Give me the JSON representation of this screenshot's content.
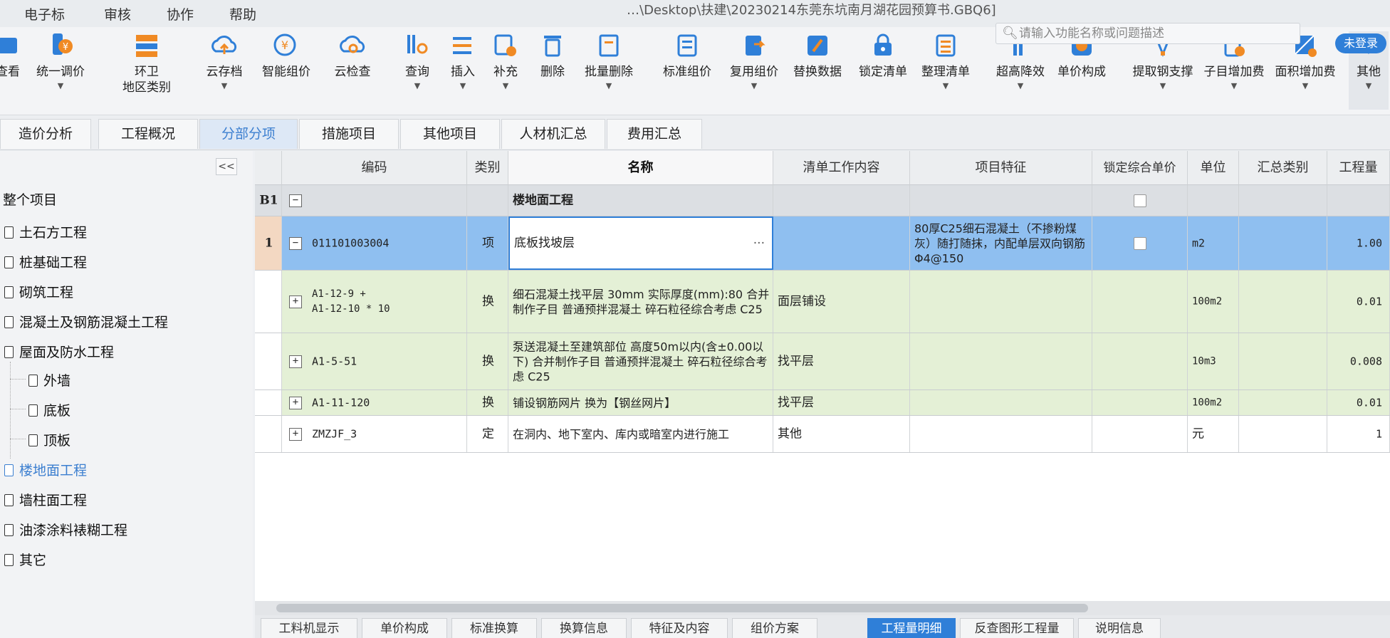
{
  "menu": {
    "items": [
      "电子标",
      "审核",
      "协作",
      "帮助"
    ],
    "window_title": "…\\Desktop\\扶建\\20230214东莞东坑南月湖花园预算书.GBQ6]"
  },
  "search": {
    "placeholder": "请输入功能名称或问题描述"
  },
  "login_badge": "未登录",
  "toolbar": {
    "items": [
      {
        "label": "查看",
        "icon": "view-icon"
      },
      {
        "label": "统一调价",
        "icon": "price-adjust-icon"
      },
      {
        "label": "环卫\n地区类别",
        "icon": "region-category-icon"
      },
      {
        "label": "云存档",
        "icon": "cloud-save-icon"
      },
      {
        "label": "智能组价",
        "icon": "smart-pricing-icon"
      },
      {
        "label": "云检查",
        "icon": "cloud-check-icon"
      },
      {
        "label": "查询",
        "icon": "query-icon"
      },
      {
        "label": "插入",
        "icon": "insert-icon"
      },
      {
        "label": "补充",
        "icon": "supplement-icon"
      },
      {
        "label": "删除",
        "icon": "delete-icon"
      },
      {
        "label": "批量删除",
        "icon": "batch-delete-icon"
      },
      {
        "label": "标准组价",
        "icon": "standard-pricing-icon"
      },
      {
        "label": "复用组价",
        "icon": "reuse-pricing-icon"
      },
      {
        "label": "替换数据",
        "icon": "replace-data-icon"
      },
      {
        "label": "锁定清单",
        "icon": "lock-list-icon"
      },
      {
        "label": "整理清单",
        "icon": "organize-list-icon"
      },
      {
        "label": "超高降效",
        "icon": "super-high-icon"
      },
      {
        "label": "单价构成",
        "icon": "unit-price-icon"
      },
      {
        "label": "提取钢支撑",
        "icon": "steel-support-icon"
      },
      {
        "label": "子目增加费",
        "icon": "sub-item-fee-icon"
      },
      {
        "label": "面积增加费",
        "icon": "area-fee-icon"
      },
      {
        "label": "其他",
        "icon": "other-icon"
      }
    ]
  },
  "tabs": [
    "造价分析",
    "工程概况",
    "分部分项",
    "措施项目",
    "其他项目",
    "人材机汇总",
    "费用汇总"
  ],
  "active_tab": "分部分项",
  "tree": {
    "collapse_label": "<<",
    "root": "整个项目",
    "nodes": [
      {
        "label": "土石方工程"
      },
      {
        "label": "桩基础工程"
      },
      {
        "label": "砌筑工程"
      },
      {
        "label": "混凝土及钢筋混凝土工程"
      },
      {
        "label": "屋面及防水工程"
      },
      {
        "label": "外墙"
      },
      {
        "label": "底板"
      },
      {
        "label": "顶板"
      },
      {
        "label": "楼地面工程"
      },
      {
        "label": "墙柱面工程"
      },
      {
        "label": "油漆涂料裱糊工程"
      },
      {
        "label": "其它"
      }
    ],
    "selected": "楼地面工程"
  },
  "grid": {
    "columns": [
      "编码",
      "类别",
      "名称",
      "清单工作内容",
      "项目特征",
      "锁定综合单价",
      "单位",
      "汇总类别",
      "工程量"
    ],
    "section_row": {
      "index": "B1",
      "expander": "−",
      "name": "楼地面工程"
    },
    "rows": [
      {
        "index": "1",
        "expander": "−",
        "code": "011101003004",
        "type": "项",
        "name": "底板找坡层",
        "work": "",
        "feature": "80厚C25细石混凝土（不掺粉煤灰）随打随抹，内配单层双向钢筋Φ4@150",
        "unit": "m2",
        "summary": "",
        "quantity": "1.00"
      },
      {
        "index": "",
        "expander": "+",
        "code": "A1-12-9 +\nA1-12-10 * 10",
        "type": "换",
        "name": "细石混凝土找平层 30mm  实际厚度(mm):80  合并制作子目 普通预拌混凝土 碎石粒径综合考虑 C25",
        "work": "面层铺设",
        "feature": "",
        "unit": "100m2",
        "summary": "",
        "quantity": "0.01"
      },
      {
        "index": "",
        "expander": "+",
        "code": "A1-5-51",
        "type": "换",
        "name": "泵送混凝土至建筑部位 高度50m以内(含±0.00以下)  合并制作子目 普通预拌混凝土 碎石粒径综合考虑 C25",
        "work": "找平层",
        "feature": "",
        "unit": "10m3",
        "summary": "",
        "quantity": "0.008"
      },
      {
        "index": "",
        "expander": "+",
        "code": "A1-11-120",
        "type": "换",
        "name": "铺设钢筋网片  换为【钢丝网片】",
        "work": "找平层",
        "feature": "",
        "unit": "100m2",
        "summary": "",
        "quantity": "0.01"
      },
      {
        "index": "",
        "expander": "+",
        "code": "ZMZJF_3",
        "type": "定",
        "name": "在洞内、地下室内、库内或暗室内进行施工",
        "work": "其他",
        "feature": "",
        "unit": "元",
        "summary": "",
        "quantity": "1"
      }
    ]
  },
  "bottom_tabs": [
    "工料机显示",
    "单价构成",
    "标准换算",
    "换算信息",
    "特征及内容",
    "组价方案",
    "工程量明细",
    "反查图形工程量",
    "说明信息"
  ],
  "active_bottom_tab": "工程量明细",
  "colors": {
    "accent": "#2f7fd8",
    "selected_row": "#8fbff0",
    "sub_row": "#e4f0d6"
  }
}
